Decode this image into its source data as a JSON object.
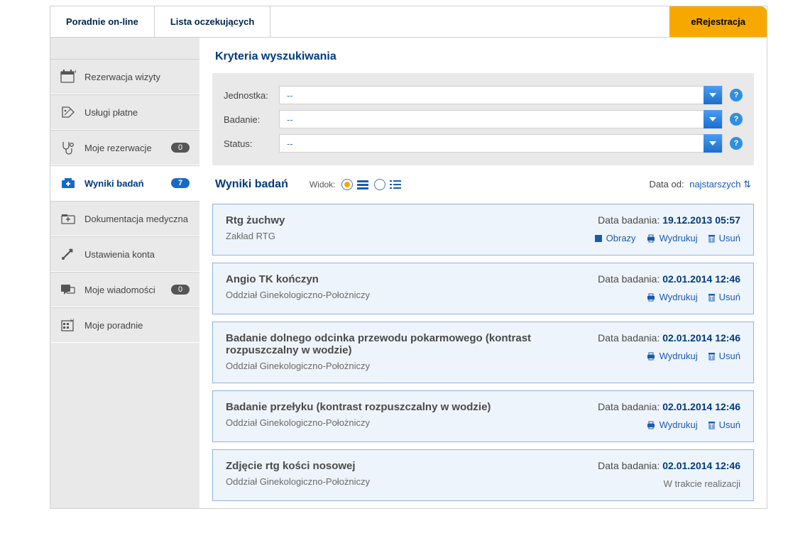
{
  "topbar": {
    "tabs": [
      "Poradnie on-line",
      "Lista oczekujących"
    ],
    "brand": "eRejestracja"
  },
  "sidebar": {
    "items": [
      {
        "icon": "calendar",
        "label": "Rezerwacja wizyty"
      },
      {
        "icon": "tag",
        "label": "Usługi płatne"
      },
      {
        "icon": "stetho",
        "label": "Moje rezerwacje",
        "badge": "0",
        "badgeClass": ""
      },
      {
        "icon": "results",
        "label": "Wyniki badań",
        "badge": "7",
        "badgeClass": "blue",
        "active": true
      },
      {
        "icon": "folder",
        "label": "Dokumentacja medyczna"
      },
      {
        "icon": "tools",
        "label": "Ustawienia konta"
      },
      {
        "icon": "msg",
        "label": "Moje wiadomości",
        "badge": "0",
        "badgeClass": ""
      },
      {
        "icon": "clinic",
        "label": "Moje poradnie"
      }
    ]
  },
  "criteria": {
    "title": "Kryteria wyszukiwania",
    "rows": [
      {
        "label": "Jednostka:",
        "value": "--"
      },
      {
        "label": "Badanie:",
        "value": "--"
      },
      {
        "label": "Status:",
        "value": "--"
      }
    ]
  },
  "results": {
    "title": "Wyniki badań",
    "viewLabel": "Widok:",
    "sort": {
      "label": "Data od:",
      "value": "najstarszych"
    },
    "dateLabel": "Data badania:",
    "actionLabels": {
      "images": "Obrazy",
      "print": "Wydrukuj",
      "del": "Usuń"
    },
    "items": [
      {
        "name": "Rtg żuchwy",
        "sub": "Zakład RTG",
        "date": "19.12.2013 05:57",
        "actions": [
          "images",
          "print",
          "del"
        ]
      },
      {
        "name": "Angio TK kończyn",
        "sub": "Oddział Ginekologiczno-Położniczy",
        "date": "02.01.2014 12:46",
        "actions": [
          "print",
          "del"
        ]
      },
      {
        "name": "Badanie dolnego odcinka przewodu pokarmowego (kontrast rozpuszczalny w wodzie)",
        "sub": "Oddział Ginekologiczno-Położniczy",
        "date": "02.01.2014 12:46",
        "actions": [
          "print",
          "del"
        ]
      },
      {
        "name": "Badanie przełyku (kontrast rozpuszczalny w wodzie)",
        "sub": "Oddział Ginekologiczno-Położniczy",
        "date": "02.01.2014 12:46",
        "actions": [
          "print",
          "del"
        ]
      },
      {
        "name": "Zdjęcie rtg kości nosowej",
        "sub": "Oddział Ginekologiczno-Położniczy",
        "date": "02.01.2014 12:46",
        "status": "W trakcie realizacji"
      }
    ]
  }
}
